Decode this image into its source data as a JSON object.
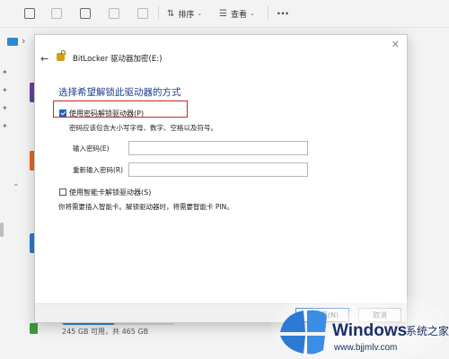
{
  "toolbar": {
    "sort_label": "排序",
    "view_label": "查看",
    "more": "···"
  },
  "dialog": {
    "title": "BitLocker 驱动器加密(E:)",
    "heading": "选择希望解锁此驱动器的方式",
    "option_password": {
      "label": "使用密码解锁驱动器(P)",
      "checked": true,
      "hint": "密码应该包含大小写字母、数字、空格以及符号。"
    },
    "password_label": "输入密码(E)",
    "password_value": "",
    "confirm_label": "重新输入密码(R)",
    "confirm_value": "",
    "option_smartcard": {
      "label": "使用智能卡解锁驱动器(S)",
      "checked": false,
      "hint": "你将需要插入智能卡。解锁驱动器时，将需要智能卡 PIN。"
    },
    "next_button": "下一页(N)",
    "cancel_button": "取消"
  },
  "drive": {
    "space_text": "245 GB 可用，共 465 GB",
    "used_fraction": 0.47
  },
  "watermark": {
    "brand": "Windows",
    "tagline": "系统之家",
    "url": "www.bjjmlv.com"
  },
  "colors": {
    "accent": "#1a64c8",
    "heading": "#1e3f8e",
    "highlight": "#d72020"
  }
}
